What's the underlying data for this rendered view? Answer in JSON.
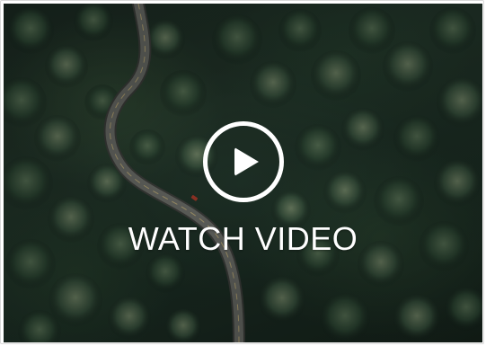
{
  "video": {
    "cta_label": "WATCH VIDEO",
    "play_icon": "play-icon",
    "thumbnail_subject": "aerial-forest-road",
    "overlay_color": "#ffffff",
    "forest_color": "#1f3328",
    "road_color": "#4a4a48"
  }
}
